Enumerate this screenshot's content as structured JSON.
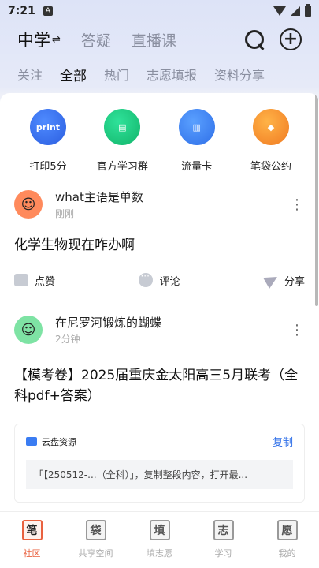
{
  "status_bar": {
    "time": "7:21",
    "notif": "A"
  },
  "header": {
    "school": "中学",
    "swap_glyph": "⇌",
    "tabs": [
      "答疑",
      "直播课"
    ]
  },
  "subtabs": [
    "关注",
    "全部",
    "热门",
    "志愿填报",
    "资料分享"
  ],
  "quick_actions": [
    {
      "label": "打印5分",
      "icon": "printer-icon",
      "glyph": "print"
    },
    {
      "label": "官方学习群",
      "icon": "chat-group-icon",
      "glyph": ""
    },
    {
      "label": "流量卡",
      "icon": "sim-card-icon",
      "glyph": ""
    },
    {
      "label": "笔袋公约",
      "icon": "pencil-bag-icon",
      "glyph": ""
    }
  ],
  "posts": [
    {
      "user": "what主语是单数",
      "time": "刚刚",
      "text": "化学生物现在咋办啊",
      "actions": {
        "like": "点赞",
        "comment": "评论",
        "share": "分享"
      }
    },
    {
      "user": "在尼罗河锻炼的蝴蝶",
      "time": "2分钟",
      "text": "【模考卷】2025届重庆金太阳高三5月联考（全科pdf+答案）",
      "resource": {
        "title": "云盘资源",
        "copy": "复制",
        "body": "「【250512-...（全科）」，复制整段内容，打开最..."
      }
    }
  ],
  "bottom_nav": [
    {
      "glyph": "笔",
      "label": "社区",
      "active": true
    },
    {
      "glyph": "袋",
      "label": "共享空间",
      "active": false
    },
    {
      "glyph": "填",
      "label": "填志愿",
      "active": false
    },
    {
      "glyph": "志",
      "label": "学习",
      "active": false
    },
    {
      "glyph": "愿",
      "label": "我的",
      "active": false
    }
  ],
  "colors": {
    "accent": "#e9613f",
    "link": "#2f6fe8"
  }
}
